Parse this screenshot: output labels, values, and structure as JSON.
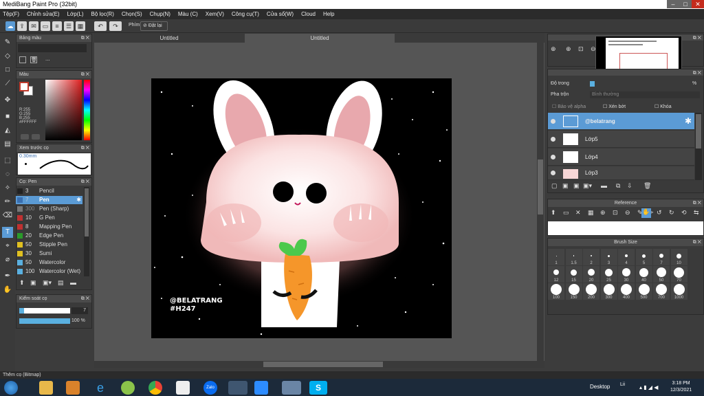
{
  "window": {
    "title": "MediBang Paint Pro (32bit)"
  },
  "menu": [
    "Tệp(F)",
    "Chỉnh sửa(E)",
    "Lớp(L)",
    "Bộ lọc(R)",
    "Chọn(S)",
    "Chụp(N)",
    "Màu (C)",
    "Xem(V)",
    "Công cụ(T)",
    "Cửa sổ(W)",
    "Cloud",
    "Help"
  ],
  "toolbar": {
    "phim_label": "Phím",
    "reset_label": "Đặt lại"
  },
  "tabs": [
    "Untitled",
    "Untitled"
  ],
  "panels": {
    "palette_title": "Bảng màu",
    "palette_dots": "...",
    "color_title": "Màu",
    "color_values": {
      "r": "R:255",
      "g": "G:255",
      "b": "B:255",
      "hex": "#FFFFFF"
    },
    "brush_preview_title": "Xem trước cọ",
    "brush_preview_size": "0.30mm",
    "brush_title": "Cọ: Pen",
    "brush_control_title": "Kiểm soát cọ",
    "brush_size_value": "7",
    "opacity_value": "100 %",
    "reference_title": "Reference",
    "brushsize_title": "Brush Size"
  },
  "brushes": [
    {
      "num": "3",
      "name": "Pencil",
      "color": "#222222"
    },
    {
      "num": "7",
      "name": "Pen",
      "color": "#3a6fb0"
    },
    {
      "num": "300",
      "name": "Pen (Sharp)",
      "color": "#777777"
    },
    {
      "num": "10",
      "name": "G Pen",
      "color": "#c03030"
    },
    {
      "num": "8",
      "name": "Mapping Pen",
      "color": "#c03030"
    },
    {
      "num": "20",
      "name": "Edge Pen",
      "color": "#2a9a2a"
    },
    {
      "num": "50",
      "name": "Stipple Pen",
      "color": "#e0c020"
    },
    {
      "num": "30",
      "name": "Sumi",
      "color": "#e0c020"
    },
    {
      "num": "50",
      "name": "Watercolor",
      "color": "#5ab0e0"
    },
    {
      "num": "100",
      "name": "Watercolor (Wet)",
      "color": "#5ab0e0"
    }
  ],
  "layers_panel": {
    "opacity_label": "Độ trong",
    "opacity_value": "%",
    "blend_label": "Pha trộn",
    "blend_value": "Bình thường",
    "protect_alpha": "Bảo vệ alpha",
    "clip": "Xén bớt",
    "lock": "Khóa"
  },
  "layers": [
    {
      "name": "@belatrang",
      "selected": true
    },
    {
      "name": "Lớp5",
      "selected": false
    },
    {
      "name": "Lớp4",
      "selected": false
    },
    {
      "name": "Lớp3",
      "selected": false
    }
  ],
  "artwork": {
    "text1": "@BELATRANG",
    "text2": "#H247"
  },
  "brush_sizes": [
    "1",
    "1.5",
    "2",
    "3",
    "4",
    "5",
    "7",
    "10",
    "12",
    "15",
    "20",
    "25",
    "30",
    "40",
    "50",
    "70",
    "100",
    "150",
    "200",
    "300",
    "400",
    "500",
    "700",
    "1000"
  ],
  "status": "Thêm cọ (Bitmap)",
  "taskbar": {
    "desktop": "Desktop",
    "lang": "Lii",
    "time": "3:18 PM",
    "date": "12/3/2021",
    "zalo": "Zalo"
  }
}
